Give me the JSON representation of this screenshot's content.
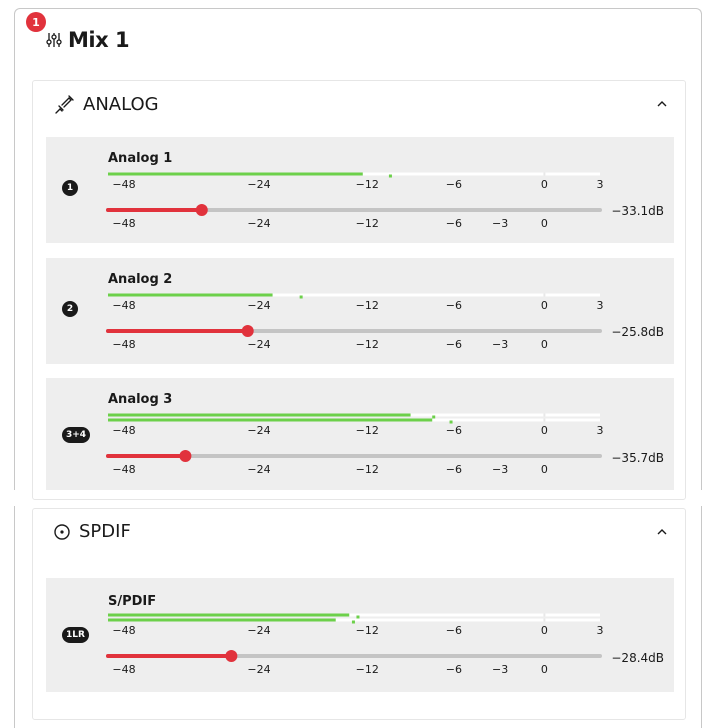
{
  "header": {
    "badge": "1",
    "title": "Mix 1",
    "icon": "mixer-icon"
  },
  "sections": {
    "analog": {
      "label": "ANALOG",
      "icon": "cable-icon"
    },
    "spdif": {
      "label": "SPDIF",
      "icon": "circle-dot-icon"
    }
  },
  "channels": [
    {
      "name": "Analog 1",
      "badge": "1",
      "db": "−33.1dB",
      "level": -33.1,
      "meters": [
        {
          "bar": -12.5,
          "peak": -10.5
        }
      ]
    },
    {
      "name": "Analog 2",
      "badge": "2",
      "db": "−25.8dB",
      "level": -25.8,
      "meters": [
        {
          "bar": -22.5,
          "peak": -19.5
        }
      ]
    },
    {
      "name": "Analog 3",
      "badge": "3+4",
      "db": "−35.7dB",
      "level": -35.7,
      "meters": [
        {
          "bar": -9,
          "peak": -7.5
        },
        {
          "bar": -7.5,
          "peak": -6.3
        }
      ]
    },
    {
      "name": "S/PDIF",
      "badge": "1LR",
      "db": "−28.4dB",
      "level": -28.4,
      "meters": [
        {
          "bar": -14,
          "peak": -13.2
        },
        {
          "bar": -15.5,
          "peak": -13.7
        }
      ]
    }
  ],
  "scales": {
    "meter": [
      "−48",
      "−24",
      "−12",
      "−6",
      "0",
      "3"
    ],
    "fader": [
      "−48",
      "−24",
      "−12",
      "−6",
      "−3",
      "0"
    ]
  },
  "colors": {
    "meter": "#6cd04a",
    "fader": "#e1323c",
    "badge": "#e1323c"
  }
}
